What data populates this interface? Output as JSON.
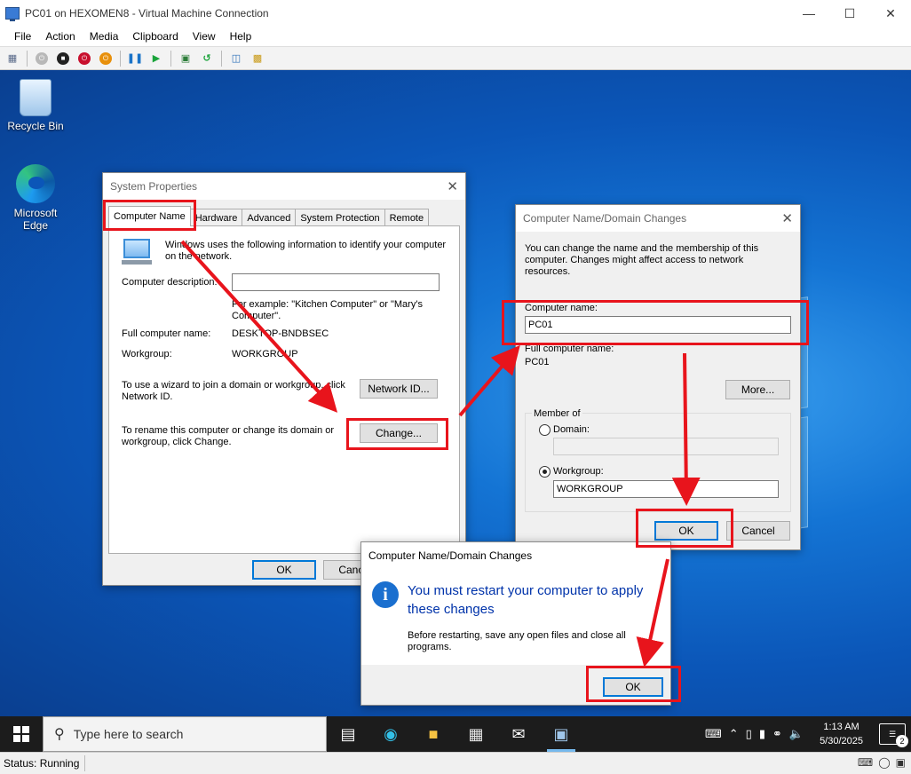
{
  "vm": {
    "title": "PC01 on HEXOMEN8 - Virtual Machine Connection",
    "menu": [
      "File",
      "Action",
      "Media",
      "Clipboard",
      "View",
      "Help"
    ],
    "status": "Status: Running"
  },
  "desktop": {
    "icons": [
      {
        "label": "Recycle Bin"
      },
      {
        "label": "Microsoft Edge"
      }
    ]
  },
  "system_properties": {
    "title": "System Properties",
    "tabs": [
      "Computer Name",
      "Hardware",
      "Advanced",
      "System Protection",
      "Remote"
    ],
    "intro": "Windows uses the following information to identify your computer on the network.",
    "description_label": "Computer description:",
    "description_value": "",
    "example": "For example: \"Kitchen Computer\" or \"Mary's Computer\".",
    "full_name_label": "Full computer name:",
    "full_name_value": "DESKTOP-BNDBSEC",
    "workgroup_label": "Workgroup:",
    "workgroup_value": "WORKGROUP",
    "network_text": "To use a wizard to join a domain or workgroup, click Network ID.",
    "network_button": "Network ID...",
    "rename_text": "To rename this computer or change its domain or workgroup, click Change.",
    "change_button": "Change...",
    "ok_button": "OK",
    "cancel_button": "Cancel"
  },
  "computer_name_changes": {
    "title": "Computer Name/Domain Changes",
    "intro": "You can change the name and the membership of this computer. Changes might affect access to network resources.",
    "computer_name_label": "Computer name:",
    "computer_name_value": "PC01",
    "full_name_label": "Full computer name:",
    "full_name_value": "PC01",
    "more_button": "More...",
    "member_of_label": "Member of",
    "domain_label": "Domain:",
    "domain_value": "",
    "workgroup_label": "Workgroup:",
    "workgroup_value": "WORKGROUP",
    "ok_button": "OK",
    "cancel_button": "Cancel"
  },
  "restart_dialog": {
    "title": "Computer Name/Domain Changes",
    "main": "You must restart your computer to apply these changes",
    "detail": "Before restarting, save any open files and close all programs.",
    "ok_button": "OK"
  },
  "taskbar": {
    "search_placeholder": "Type here to search",
    "time": "1:13 AM",
    "date": "5/30/2025",
    "notification_count": "2"
  },
  "colors": {
    "highlight": "#e8141c",
    "accent": "#0078d7",
    "info_text": "#0033aa"
  }
}
